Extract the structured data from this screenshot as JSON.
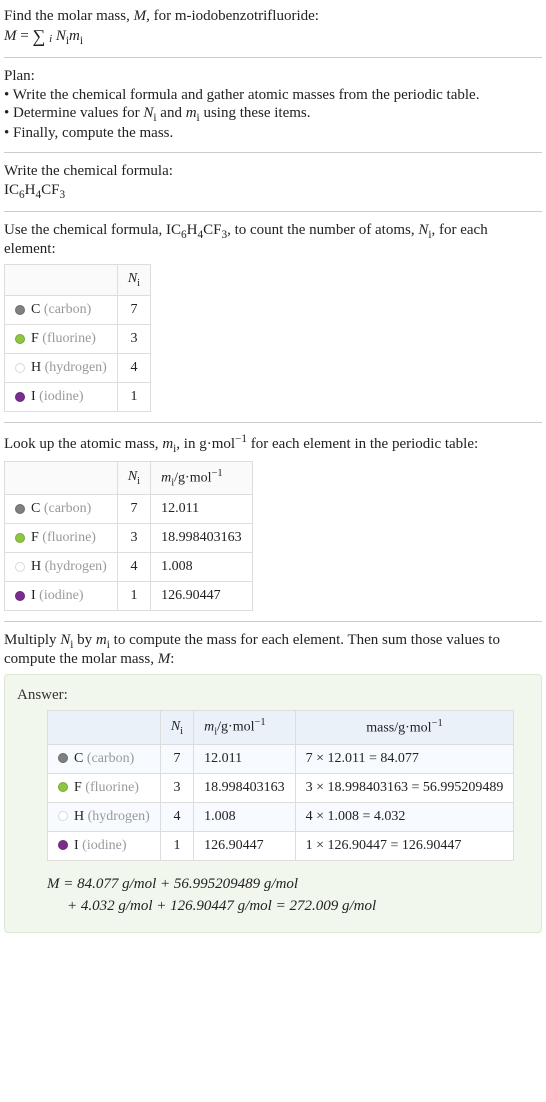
{
  "intro": {
    "line1_prefix": "Find the molar mass, ",
    "line1_var": "M",
    "line1_suffix": ", for m-iodobenzotrifluoride:",
    "eq_lhs": "M",
    "eq_rhs_N": "N",
    "eq_rhs_m": "m",
    "eq_idx": "i"
  },
  "plan": {
    "title": "Plan:",
    "b1": "• Write the chemical formula and gather atomic masses from the periodic table.",
    "b2_pre": "• Determine values for ",
    "b2_n": "N",
    "b2_i": "i",
    "b2_mid": " and ",
    "b2_m": "m",
    "b2_suf": " using these items.",
    "b3": "• Finally, compute the mass."
  },
  "step1": {
    "title": "Write the chemical formula:",
    "formula_html": "IC₆H₄CF₃",
    "parts": {
      "p1": "IC",
      "s1": "6",
      "p2": "H",
      "s2": "4",
      "p3": "CF",
      "s3": "3"
    }
  },
  "step2": {
    "pre": "Use the chemical formula, ",
    "mid": ", to count the number of atoms, ",
    "var_n": "N",
    "var_i": "i",
    "suf": ", for each element:",
    "header_n": "N",
    "header_i": "i"
  },
  "elements": [
    {
      "dot": "dot-c",
      "sym": "C",
      "name": "(carbon)",
      "n": "7",
      "m": "12.011",
      "mass": "7 × 12.011 = 84.077"
    },
    {
      "dot": "dot-f",
      "sym": "F",
      "name": "(fluorine)",
      "n": "3",
      "m": "18.998403163",
      "mass": "3 × 18.998403163 = 56.995209489"
    },
    {
      "dot": "dot-h",
      "sym": "H",
      "name": "(hydrogen)",
      "n": "4",
      "m": "1.008",
      "mass": "4 × 1.008 = 4.032"
    },
    {
      "dot": "dot-i",
      "sym": "I",
      "name": "(iodine)",
      "n": "1",
      "m": "126.90447",
      "mass": "1 × 126.90447 = 126.90447"
    }
  ],
  "step3": {
    "pre": "Look up the atomic mass, ",
    "var_m": "m",
    "var_i": "i",
    "mid": ", in g·mol",
    "expo": "−1",
    "suf": " for each element in the periodic table:",
    "hdr_m": "m",
    "hdr_i": "i",
    "hdr_unit_pre": "/g·mol",
    "hdr_unit_exp": "−1"
  },
  "step4": {
    "l1_pre": "Multiply ",
    "l1_n": "N",
    "l1_i": "i",
    "l1_mid": " by ",
    "l1_m": "m",
    "l1_suf": " to compute the mass for each element. Then sum those values to compute the molar mass, ",
    "l1_M": "M",
    "l1_end": ":"
  },
  "answer": {
    "label": "Answer:",
    "hdr_mass_pre": "mass/g·mol",
    "hdr_mass_exp": "−1",
    "final_l1": "M = 84.077 g/mol + 56.995209489 g/mol",
    "final_l2": "+ 4.032 g/mol + 126.90447 g/mol = 272.009 g/mol"
  }
}
